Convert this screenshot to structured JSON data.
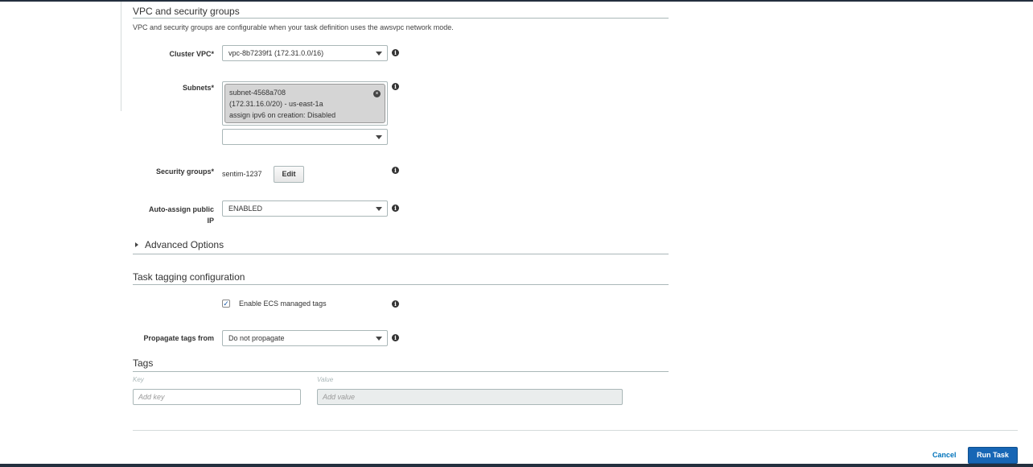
{
  "vpc_section": {
    "title": "VPC and security groups",
    "description": "VPC and security groups are configurable when your task definition uses the awsvpc network mode."
  },
  "cluster_vpc": {
    "label": "Cluster VPC*",
    "value": "vpc-8b7239f1 (172.31.0.0/16)"
  },
  "subnets": {
    "label": "Subnets*",
    "token_lines": [
      "subnet-4568a708",
      "(172.31.16.0/20) - us-east-1a",
      "assign ipv6 on creation: Disabled"
    ],
    "select_value": ""
  },
  "security_groups": {
    "label": "Security groups*",
    "value": "sentim-1237",
    "edit_label": "Edit"
  },
  "auto_assign_ip": {
    "label": "Auto-assign public IP",
    "value": "ENABLED"
  },
  "advanced_options": {
    "label": "Advanced Options",
    "expanded": false
  },
  "task_tagging": {
    "title": "Task tagging configuration",
    "ecs_tags_label": "Enable ECS managed tags",
    "ecs_tags_checked": true,
    "propagate_label": "Propagate tags from",
    "propagate_value": "Do not propagate"
  },
  "tags": {
    "title": "Tags",
    "key_header": "Key",
    "value_header": "Value",
    "key_placeholder": "Add key",
    "value_placeholder": "Add value"
  },
  "footer": {
    "cancel_label": "Cancel",
    "run_label": "Run Task"
  },
  "icons": {
    "info": "info-icon",
    "caret": "caret-down-icon",
    "close": "close-circle-icon",
    "check": "checkmark-icon"
  },
  "colors": {
    "accent": "#1766b5",
    "link": "#0073bb",
    "header_bar": "#232f3e"
  }
}
